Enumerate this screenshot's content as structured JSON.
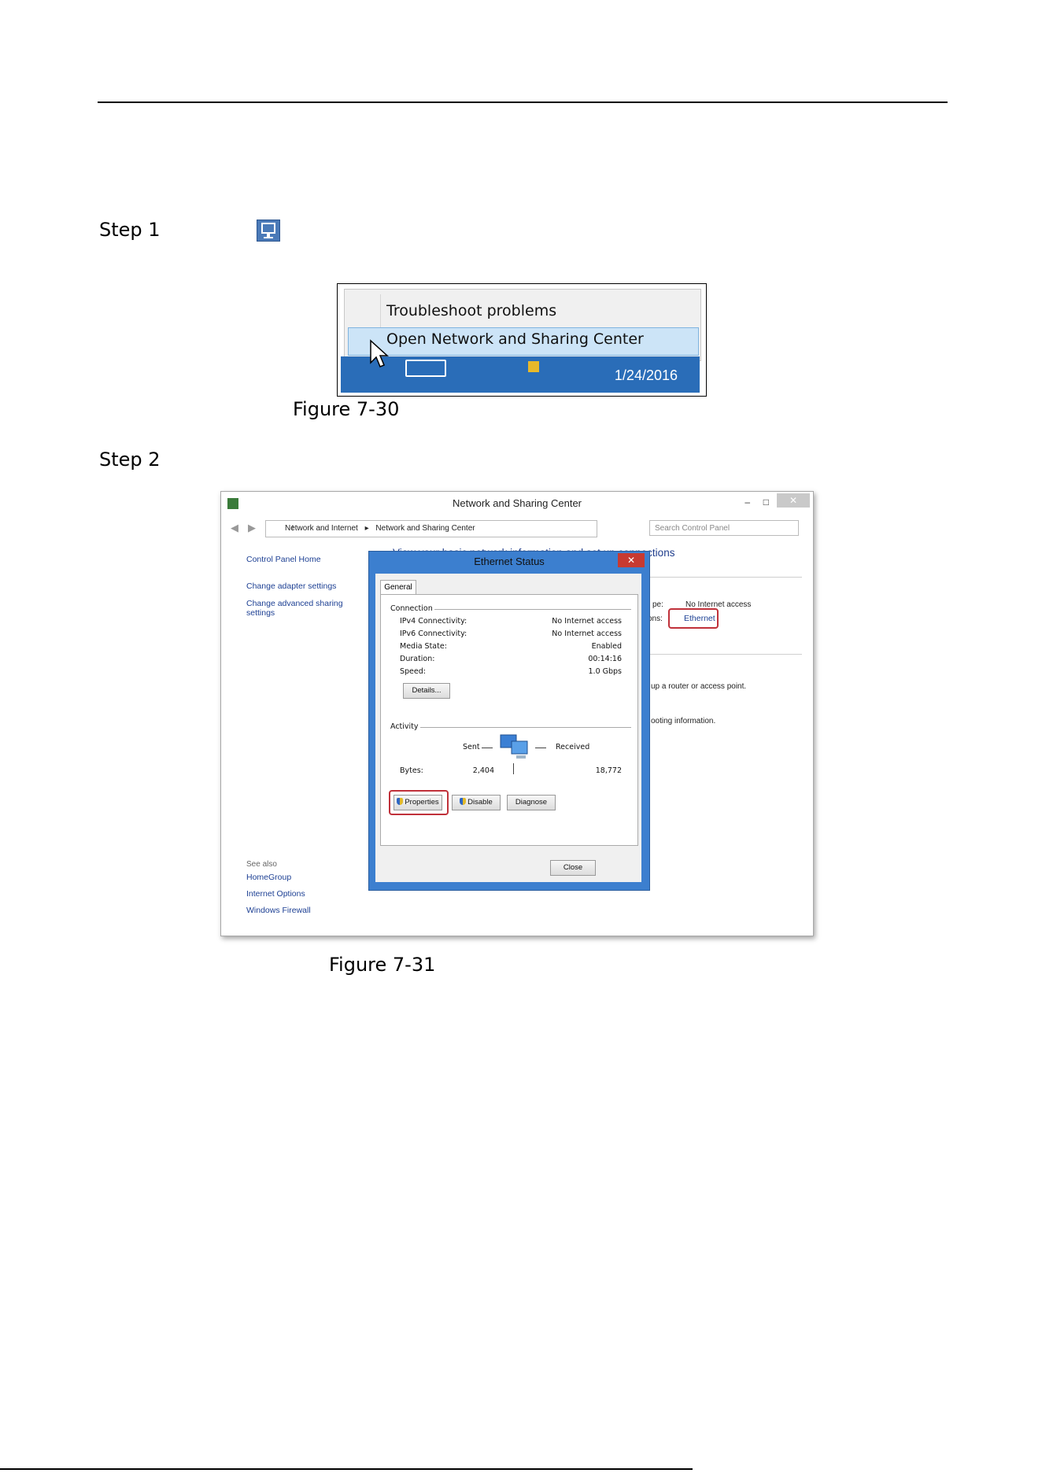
{
  "steps": {
    "step1_label": "Step 1",
    "step2_label": "Step 2"
  },
  "figure_30": {
    "caption": "Figure 7-30",
    "menu_items": [
      "Troubleshoot problems",
      "Open Network and Sharing Center"
    ],
    "taskbar_date": "1/24/2016"
  },
  "figure_31": {
    "caption": "Figure 7-31",
    "window": {
      "title": "Network and Sharing Center",
      "breadcrumb": [
        "Network and Internet",
        "Network and Sharing Center"
      ],
      "search_placeholder": "Search Control Panel",
      "left_links": [
        "Control Panel Home",
        "Change adapter settings",
        "Change advanced sharing settings"
      ],
      "see_also_label": "See also",
      "see_also_links": [
        "HomeGroup",
        "Internet Options",
        "Windows Firewall"
      ],
      "main_header": "View your basic network information and set up connections",
      "access_type_label": "pe:",
      "access_type_value": "No Internet access",
      "connections_label": "ons:",
      "connections_link": "Ethernet",
      "router_text": "up a router or access point.",
      "troubleshoot_text": "ooting information."
    },
    "dialog": {
      "title": "Ethernet Status",
      "tab": "General",
      "connection_label": "Connection",
      "rows": [
        {
          "label": "IPv4 Connectivity:",
          "value": "No Internet access"
        },
        {
          "label": "IPv6 Connectivity:",
          "value": "No Internet access"
        },
        {
          "label": "Media State:",
          "value": "Enabled"
        },
        {
          "label": "Duration:",
          "value": "00:14:16"
        },
        {
          "label": "Speed:",
          "value": "1.0 Gbps"
        }
      ],
      "details_button": "Details...",
      "activity_label": "Activity",
      "sent_label": "Sent",
      "received_label": "Received",
      "bytes_label": "Bytes:",
      "bytes_sent": "2,404",
      "bytes_received": "18,772",
      "properties_button": "Properties",
      "disable_button": "Disable",
      "diagnose_button": "Diagnose",
      "close_button": "Close"
    }
  }
}
